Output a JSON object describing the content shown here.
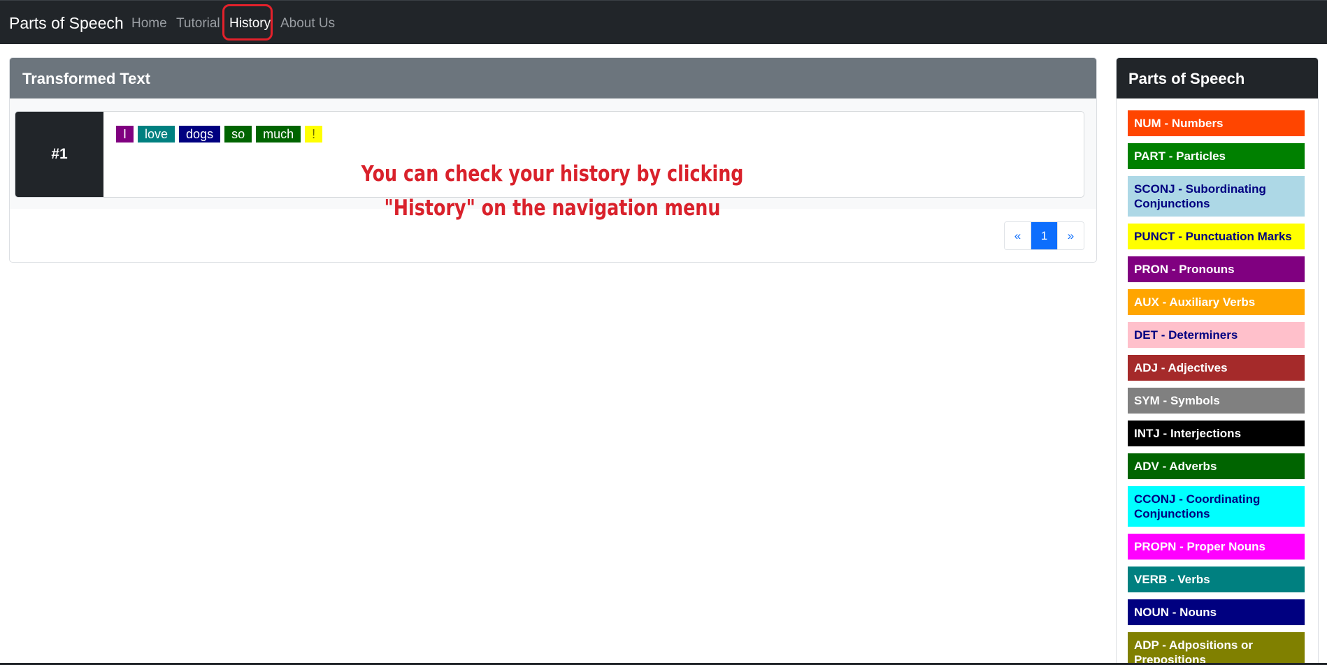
{
  "navbar": {
    "brand": "Parts of Speech",
    "links": [
      "Home",
      "Tutorial",
      "History",
      "About Us"
    ],
    "active": "History"
  },
  "main": {
    "title": "Transformed Text",
    "entry": {
      "number": "#1",
      "tokens": [
        {
          "text": "I",
          "tag": "PRON",
          "color": "#800080",
          "text_color": "#ffffff"
        },
        {
          "text": "love",
          "tag": "VERB",
          "color": "#008080",
          "text_color": "#ffffff"
        },
        {
          "text": "dogs",
          "tag": "NOUN",
          "color": "#000080",
          "text_color": "#ffffff"
        },
        {
          "text": "so",
          "tag": "ADV",
          "color": "#006400",
          "text_color": "#ffffff"
        },
        {
          "text": "much",
          "tag": "ADV",
          "color": "#006400",
          "text_color": "#ffffff"
        },
        {
          "text": "!",
          "tag": "PUNCT",
          "color": "#ffff00",
          "text_color": "#6b6b00"
        }
      ]
    },
    "annotation": {
      "line1": "You can check your history by clicking",
      "line2": "\"History\" on the navigation menu",
      "color": "#d9212b"
    },
    "pagination": {
      "prev": "«",
      "current": "1",
      "next": "»"
    }
  },
  "sidebar": {
    "title": "Parts of Speech",
    "items": [
      {
        "label": "NUM - Numbers",
        "bg": "#ff4500",
        "fg": "#ffffff",
        "lines": 1
      },
      {
        "label": "PART - Particles",
        "bg": "#008000",
        "fg": "#ffffff",
        "lines": 1
      },
      {
        "label": "SCONJ - Subordinating Conjunctions",
        "bg": "#add8e6",
        "fg": "#000080",
        "lines": 2
      },
      {
        "label": "PUNCT - Punctuation Marks",
        "bg": "#ffff00",
        "fg": "#000080",
        "lines": 1
      },
      {
        "label": "PRON - Pronouns",
        "bg": "#800080",
        "fg": "#ffffff",
        "lines": 1
      },
      {
        "label": "AUX - Auxiliary Verbs",
        "bg": "#ffa500",
        "fg": "#ffffff",
        "lines": 1
      },
      {
        "label": "DET - Determiners",
        "bg": "#ffc0cb",
        "fg": "#000080",
        "lines": 1
      },
      {
        "label": "ADJ - Adjectives",
        "bg": "#a52a2a",
        "fg": "#ffffff",
        "lines": 1
      },
      {
        "label": "SYM - Symbols",
        "bg": "#808080",
        "fg": "#ffffff",
        "lines": 1
      },
      {
        "label": "INTJ - Interjections",
        "bg": "#000000",
        "fg": "#ffffff",
        "lines": 1
      },
      {
        "label": "ADV - Adverbs",
        "bg": "#006400",
        "fg": "#ffffff",
        "lines": 1
      },
      {
        "label": "CCONJ - Coordinating Conjunctions",
        "bg": "#00ffff",
        "fg": "#000080",
        "lines": 2
      },
      {
        "label": "PROPN - Proper Nouns",
        "bg": "#ff00ff",
        "fg": "#ffffff",
        "lines": 1
      },
      {
        "label": "VERB - Verbs",
        "bg": "#008080",
        "fg": "#ffffff",
        "lines": 1
      },
      {
        "label": "NOUN - Nouns",
        "bg": "#000080",
        "fg": "#ffffff",
        "lines": 1
      },
      {
        "label": "ADP - Adpositions or Prepositions",
        "bg": "#808000",
        "fg": "#ffffff",
        "lines": 2
      }
    ]
  }
}
